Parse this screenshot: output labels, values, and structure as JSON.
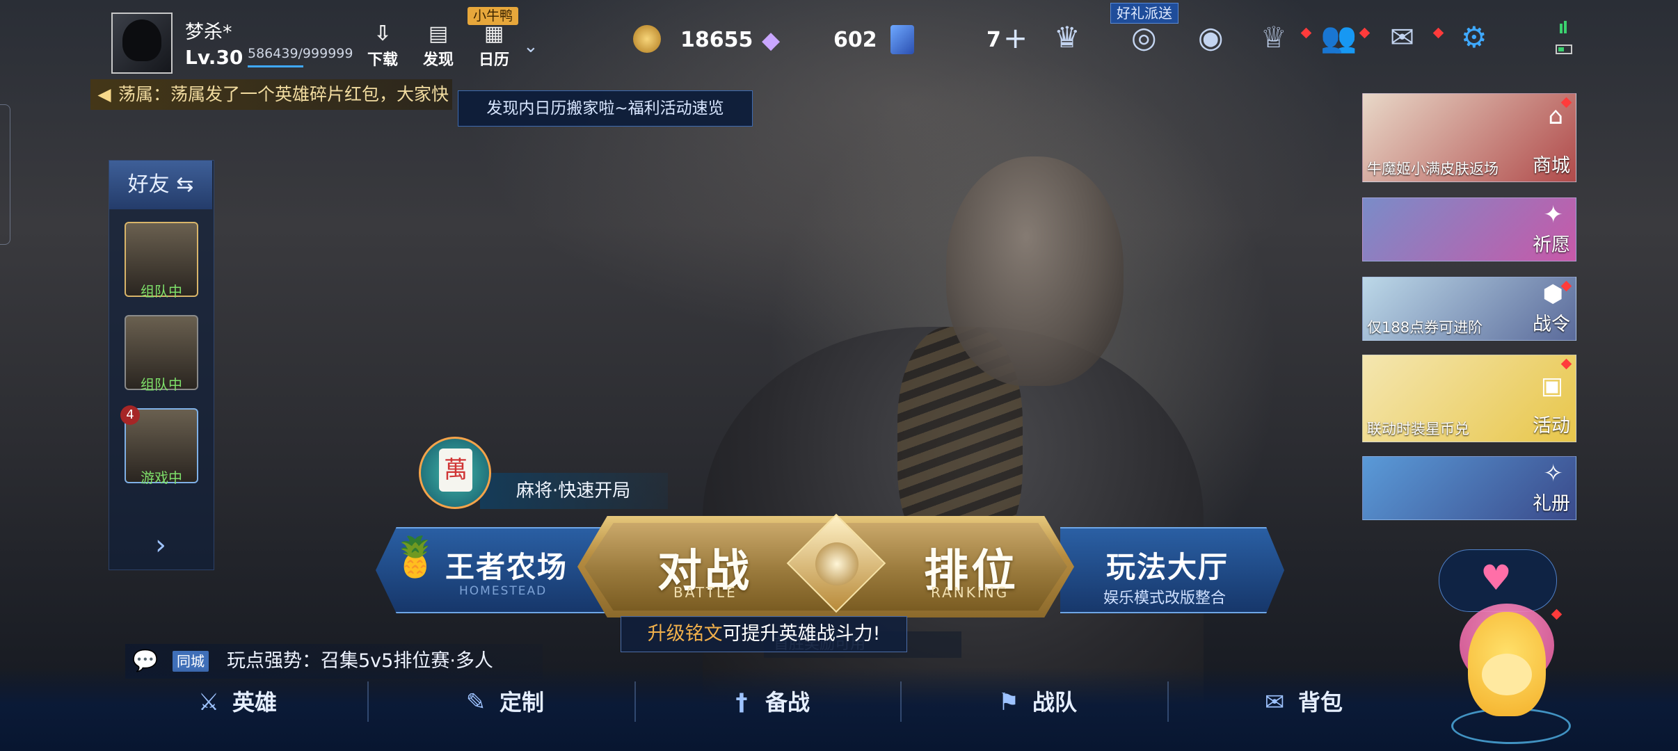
{
  "profile": {
    "name": "梦杀*",
    "level": "Lv.30",
    "exp": "586439/999999"
  },
  "topbar": {
    "download_label": "下载",
    "discover_label": "发现",
    "calendar_label": "日历",
    "calendar_tag": "小牛鸭",
    "tooltip": "发现内日历搬家啦~福利活动速览",
    "gift_tag": "好礼派送"
  },
  "announcement": {
    "text": "荡属：荡属发了一个英雄碎片红包，大家快"
  },
  "currency": {
    "gold": "18655",
    "diamond": "602",
    "coupon": "7"
  },
  "friends": {
    "title": "好友",
    "list": [
      {
        "status": "组队中",
        "status_color": "#7ee06a"
      },
      {
        "status": "组队中",
        "status_color": "#7ee06a"
      },
      {
        "status": "游戏中",
        "status_color": "#7ee06a",
        "badge": "4"
      }
    ]
  },
  "mahjong": {
    "label": "麻将·快速开局",
    "tile": "萬"
  },
  "modes": {
    "farm_title": "王者农场",
    "farm_sub": "HOMESTEAD",
    "battle_title": "对战",
    "battle_sub": "BATTLE",
    "rank_title": "排位",
    "rank_sub": "RANKING",
    "lobby_title": "玩法大厅",
    "lobby_sub": "娱乐模式改版整合"
  },
  "tips": {
    "inscription_highlight": "升级铭文",
    "inscription_rest": "可提升英雄战斗力!",
    "ghost": "首胜奖励可用"
  },
  "chat": {
    "tag": "同城",
    "message": "玩点强势：召集5v5排位赛·多人"
  },
  "nav": [
    {
      "label": "英雄",
      "icon": "hero-icon"
    },
    {
      "label": "定制",
      "icon": "custom-icon"
    },
    {
      "label": "备战",
      "icon": "sword-icon"
    },
    {
      "label": "战队",
      "icon": "team-icon"
    },
    {
      "label": "背包",
      "icon": "bag-icon"
    }
  ],
  "events": [
    {
      "caption": "牛魔姬小满皮肤返场",
      "side": "商城",
      "colors": [
        "#e8d8c8",
        "#b04a4a"
      ]
    },
    {
      "caption": "",
      "side": "祈愿",
      "colors": [
        "#7a8cc8",
        "#c858a8"
      ]
    },
    {
      "caption": "仅188点券可进阶",
      "side": "战令",
      "colors": [
        "#bcd8e8",
        "#5a6a9a"
      ]
    },
    {
      "caption": "联动时装星币兑",
      "side": "活动",
      "colors": [
        "#f4e6b0",
        "#e8c64a"
      ]
    },
    {
      "caption": "",
      "side": "礼册",
      "colors": [
        "#5a9ad8",
        "#3a4a8a"
      ]
    }
  ],
  "colors": {
    "gold_accent": "#f1b04b",
    "blue_accent": "#3fa9ff",
    "red_dot": "#ff3b3b"
  }
}
